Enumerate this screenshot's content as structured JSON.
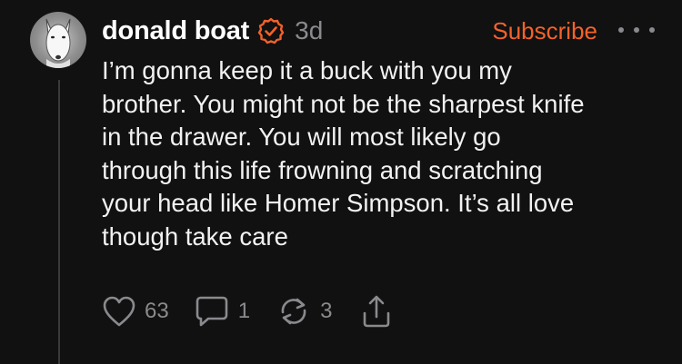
{
  "post": {
    "author": "donald boat",
    "verified": true,
    "time_ago": "3d",
    "subscribe_label": "Subscribe",
    "text": "I’m gonna keep it a buck with you my\nbrother. You might not be the sharpest knife\nin the drawer. You will most likely go\nthrough this life frowning and scratching\nyour head like Homer Simpson. It’s all love\nthough take care"
  },
  "actions": {
    "likes": "63",
    "replies": "1",
    "reposts": "3"
  },
  "icons": {
    "avatar": "bull-terrier-avatar",
    "verified": "verified-check-icon",
    "more": "more-dots-icon",
    "like": "heart-icon",
    "reply": "comment-icon",
    "repost": "repost-icon",
    "share": "share-icon"
  },
  "colors": {
    "background": "#111111",
    "accent": "#f4622a",
    "muted": "#8a8a8e",
    "text": "#f2f2f2"
  }
}
